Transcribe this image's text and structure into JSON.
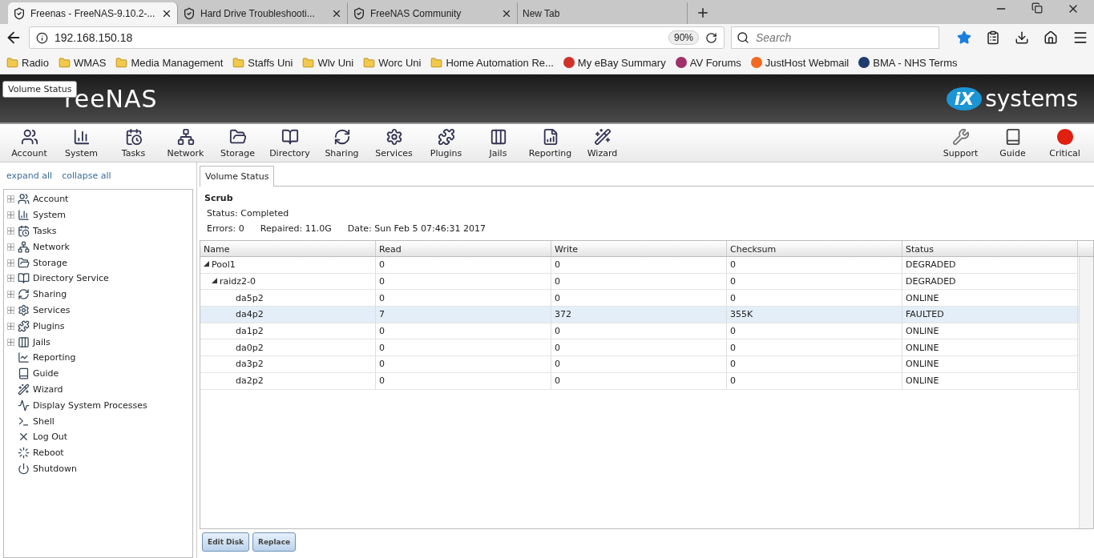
{
  "browser": {
    "tabs": [
      {
        "title": "Freenas - FreeNAS-9.10.2-...",
        "selected": true
      },
      {
        "title": "Hard Drive Troubleshooti...",
        "selected": false
      },
      {
        "title": "FreeNAS Community",
        "selected": false
      },
      {
        "title": "New Tab",
        "selected": false
      }
    ],
    "address": "192.168.150.18",
    "zoom": "90%",
    "search": {
      "placeholder": "Search"
    },
    "bookmarks": [
      {
        "label": "Radio",
        "kind": "folder"
      },
      {
        "label": "WMAS",
        "kind": "folder"
      },
      {
        "label": "Media Management",
        "kind": "folder"
      },
      {
        "label": "Staffs Uni",
        "kind": "folder"
      },
      {
        "label": "Wlv Uni",
        "kind": "folder"
      },
      {
        "label": "Worc Uni",
        "kind": "folder"
      },
      {
        "label": "Home Automation Re...",
        "kind": "folder"
      },
      {
        "label": "My eBay Summary",
        "kind": "site",
        "color": "#d0302a"
      },
      {
        "label": "AV Forums",
        "kind": "site",
        "color": "#a0306a"
      },
      {
        "label": "JustHost Webmail",
        "kind": "site",
        "color": "#f26a21"
      },
      {
        "label": "BMA - NHS Terms",
        "kind": "site",
        "color": "#1f3a70"
      }
    ]
  },
  "header": {
    "logo": "reeNAS",
    "tooltip": "Volume Status",
    "brand_mark": "iX",
    "brand": "systems"
  },
  "toolbar": {
    "left": [
      "Account",
      "System",
      "Tasks",
      "Network",
      "Storage",
      "Directory",
      "Sharing",
      "Services",
      "Plugins",
      "Jails",
      "Reporting",
      "Wizard"
    ],
    "right": [
      "Support",
      "Guide",
      "Critical"
    ]
  },
  "sidebar": {
    "expand_all": "expand all",
    "collapse_all": "collapse all",
    "items": [
      {
        "label": "Account",
        "expandable": true
      },
      {
        "label": "System",
        "expandable": true
      },
      {
        "label": "Tasks",
        "expandable": true
      },
      {
        "label": "Network",
        "expandable": true
      },
      {
        "label": "Storage",
        "expandable": true
      },
      {
        "label": "Directory Service",
        "expandable": true
      },
      {
        "label": "Sharing",
        "expandable": true
      },
      {
        "label": "Services",
        "expandable": true
      },
      {
        "label": "Plugins",
        "expandable": true
      },
      {
        "label": "Jails",
        "expandable": true
      },
      {
        "label": "Reporting",
        "expandable": false
      },
      {
        "label": "Guide",
        "expandable": false
      },
      {
        "label": "Wizard",
        "expandable": false
      },
      {
        "label": "Display System Processes",
        "expandable": false
      },
      {
        "label": "Shell",
        "expandable": false
      },
      {
        "label": "Log Out",
        "expandable": false
      },
      {
        "label": "Reboot",
        "expandable": false
      },
      {
        "label": "Shutdown",
        "expandable": false
      }
    ]
  },
  "content_tabs": [
    {
      "label": "Volume Status",
      "selected": true
    }
  ],
  "scrub": {
    "title": "Scrub",
    "status": "Status: Completed",
    "errors": "Errors: 0",
    "repaired": "Repaired: 11.0G",
    "date": "Date: Sun Feb 5 07:46:31 2017"
  },
  "table": {
    "columns": [
      "Name",
      "Read",
      "Write",
      "Checksum",
      "Status"
    ],
    "rows": [
      {
        "name": "Pool1",
        "read": "0",
        "write": "0",
        "checksum": "0",
        "status": "DEGRADED",
        "selected": false,
        "expanded": true,
        "children": [
          {
            "name": "raidz2-0",
            "read": "0",
            "write": "0",
            "checksum": "0",
            "status": "DEGRADED",
            "selected": false,
            "expanded": true,
            "children": [
              {
                "name": "da5p2",
                "read": "0",
                "write": "0",
                "checksum": "0",
                "status": "ONLINE",
                "selected": false
              },
              {
                "name": "da4p2",
                "read": "7",
                "write": "372",
                "checksum": "355K",
                "status": "FAULTED",
                "selected": true
              },
              {
                "name": "da1p2",
                "read": "0",
                "write": "0",
                "checksum": "0",
                "status": "ONLINE",
                "selected": false
              },
              {
                "name": "da0p2",
                "read": "0",
                "write": "0",
                "checksum": "0",
                "status": "ONLINE",
                "selected": false
              },
              {
                "name": "da3p2",
                "read": "0",
                "write": "0",
                "checksum": "0",
                "status": "ONLINE",
                "selected": false
              },
              {
                "name": "da2p2",
                "read": "0",
                "write": "0",
                "checksum": "0",
                "status": "ONLINE",
                "selected": false
              }
            ]
          }
        ]
      }
    ]
  },
  "buttons": [
    "Edit Disk",
    "Replace"
  ]
}
